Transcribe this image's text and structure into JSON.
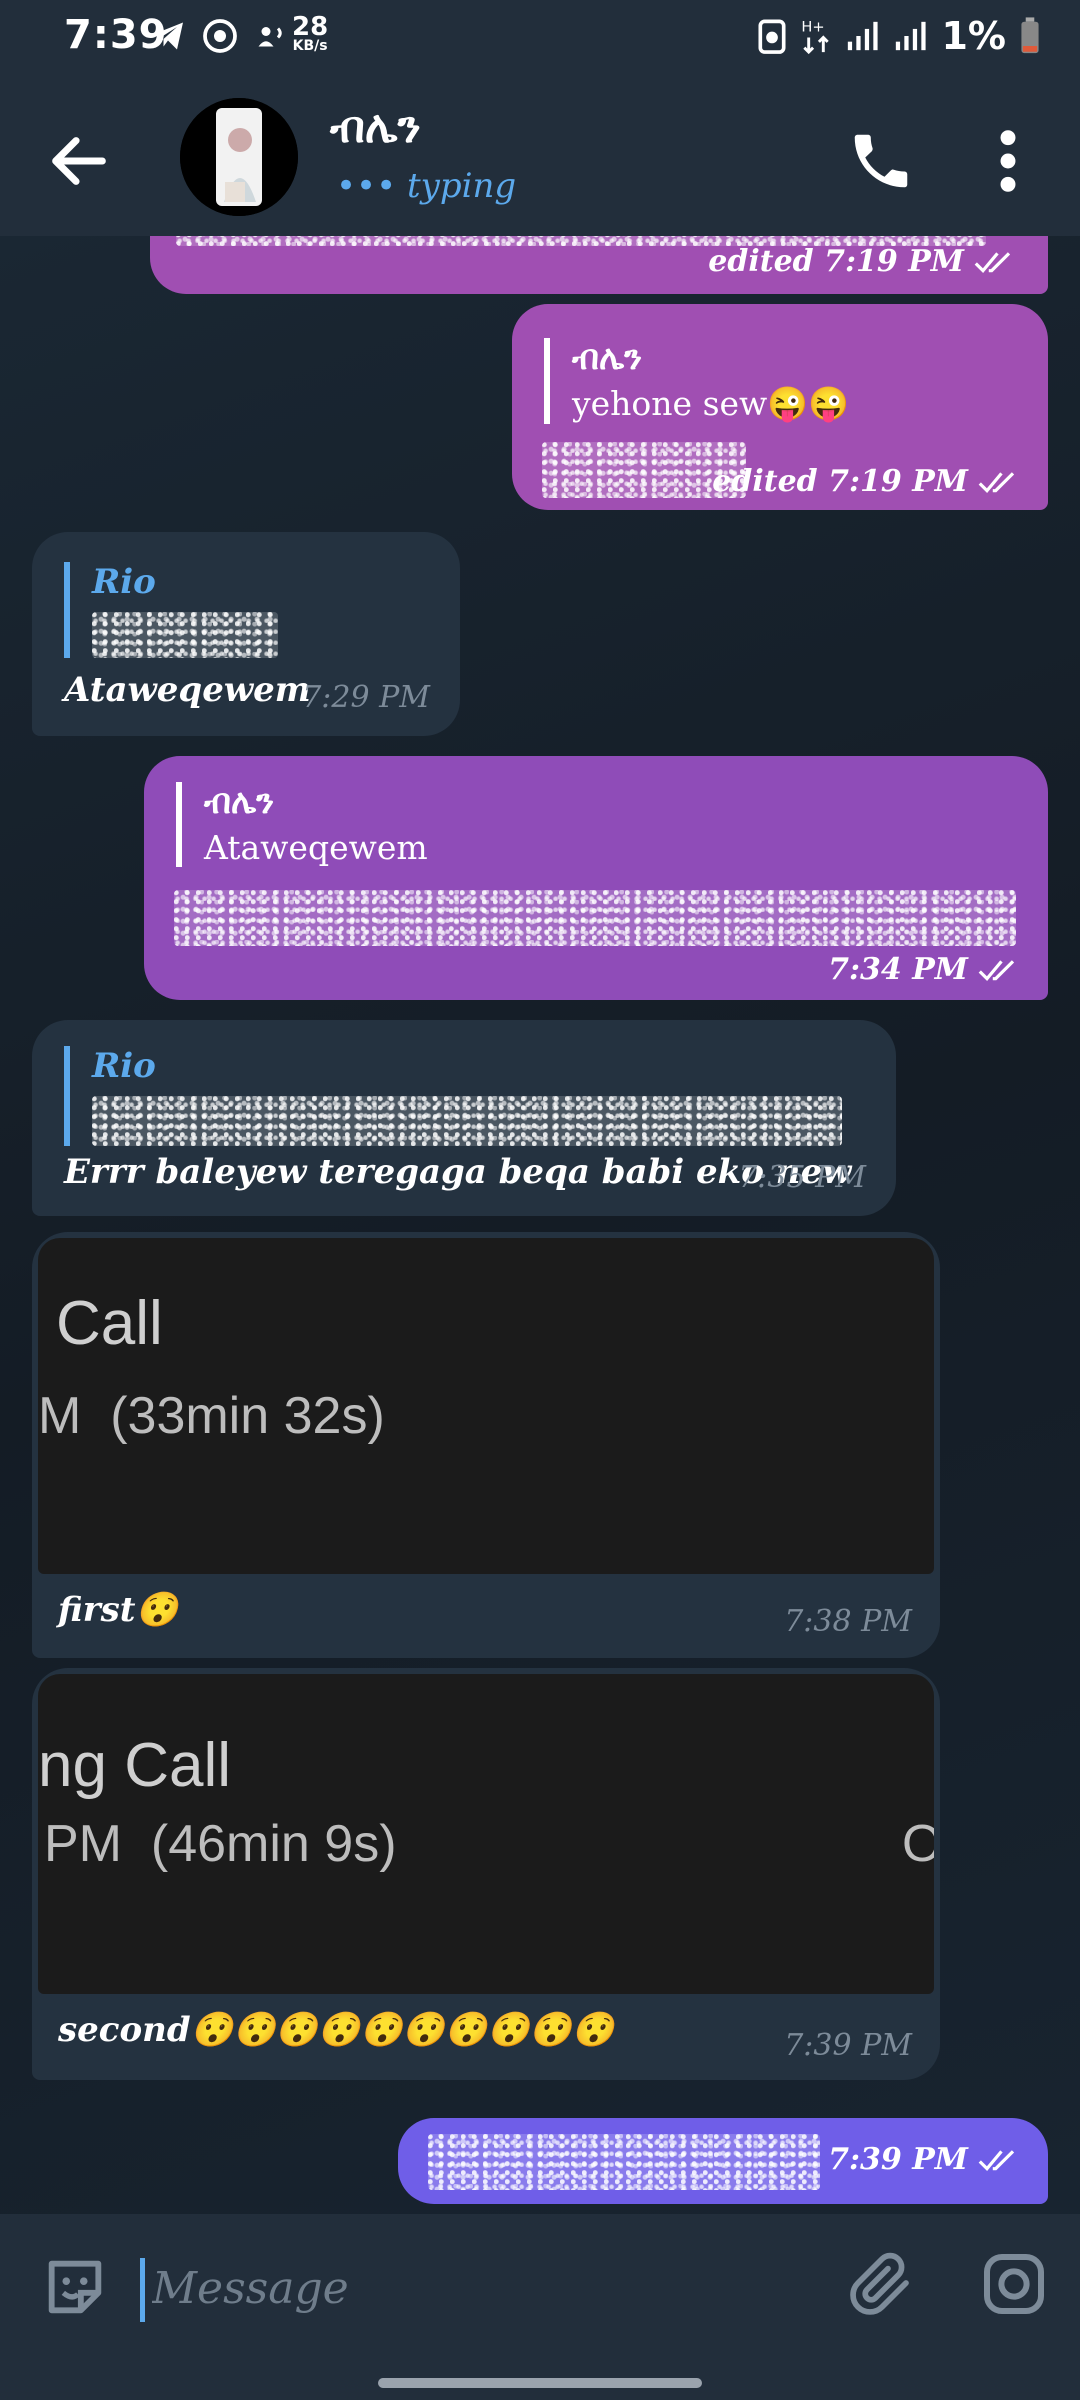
{
  "status_bar": {
    "time": "7:39",
    "net_speed": "28",
    "net_unit": "KB/s",
    "battery": "1%"
  },
  "header": {
    "title": "ብሌን",
    "status": "••• typing"
  },
  "messages": [
    {
      "meta": "edited 7:19 PM"
    },
    {
      "reply_name": "ብሌን",
      "reply_text": "yehone sew😜😜",
      "meta": "edited 7:19 PM"
    },
    {
      "reply_name": "Rio",
      "text": "Ataweqewem",
      "meta": "7:29 PM"
    },
    {
      "reply_name": "ብሌን",
      "reply_text": "Ataweqewem",
      "meta": "7:34 PM"
    },
    {
      "reply_name": "Rio",
      "text": "Errr baleyew teregaga beqa babi eko new",
      "meta": "7:35 PM"
    },
    {
      "media_line1": "Call",
      "media_line2": "M  (33min 32s)",
      "text": "first😯",
      "meta": "7:38 PM"
    },
    {
      "media_line1": "ng Call",
      "media_line2": "PM  (46min 9s)",
      "media_side": "O",
      "text": "second😯😯😯😯😯😯😯😯😯😯",
      "meta": "7:39 PM"
    },
    {
      "meta": "7:39 PM"
    }
  ],
  "input": {
    "placeholder": "Message"
  },
  "colors": {
    "accent": "#5ca9ec",
    "outgoing": "#a04fb2",
    "incoming": "#243240",
    "header": "#222e3b"
  },
  "icons": [
    "back-arrow-icon",
    "phone-icon",
    "more-vertical-icon",
    "sticker-icon",
    "paperclip-icon",
    "camera-icon",
    "double-check-icon"
  ]
}
